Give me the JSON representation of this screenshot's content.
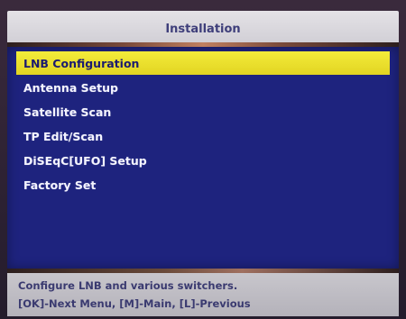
{
  "window": {
    "title": "Installation"
  },
  "menu": {
    "items": [
      {
        "label": "LNB Configuration",
        "selected": true
      },
      {
        "label": "Antenna Setup",
        "selected": false
      },
      {
        "label": "Satellite Scan",
        "selected": false
      },
      {
        "label": "TP Edit/Scan",
        "selected": false
      },
      {
        "label": "DiSEqC[UFO] Setup",
        "selected": false
      },
      {
        "label": "Factory Set",
        "selected": false
      }
    ]
  },
  "help": {
    "line1": "Configure LNB and various switchers.",
    "line2": "[OK]-Next Menu, [M]-Main, [L]-Previous"
  },
  "colors": {
    "panel": "#1e237e",
    "highlight": "#f3ec3a",
    "title_bar": "#dcdade",
    "help_bar": "#c0bec4"
  }
}
